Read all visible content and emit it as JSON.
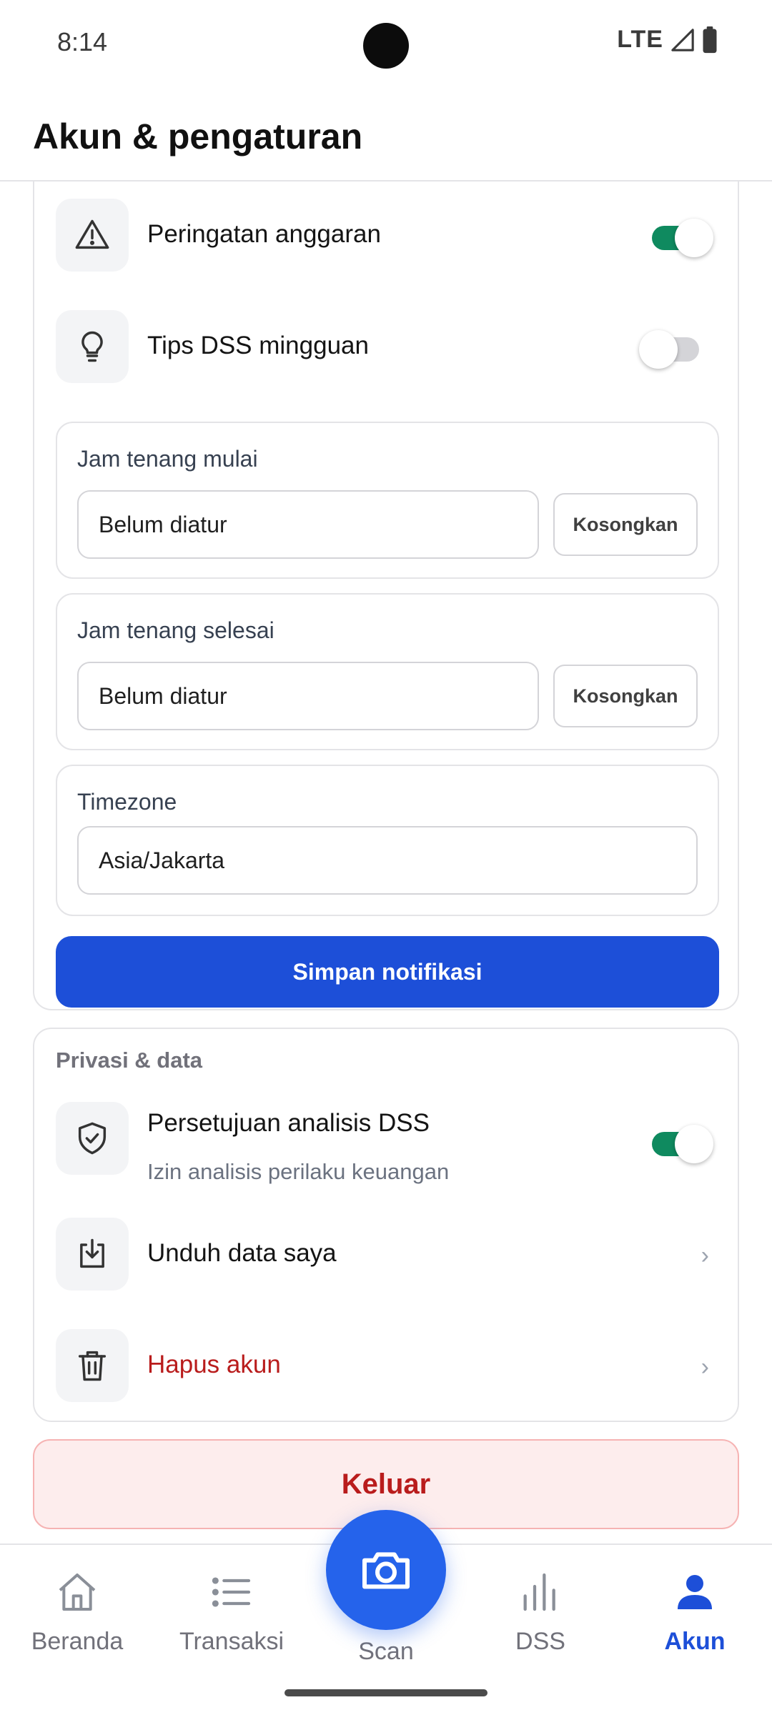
{
  "status_bar": {
    "time": "8:14",
    "network": "LTE"
  },
  "header": {
    "title": "Akun & pengaturan"
  },
  "notifications": {
    "budget_warning": {
      "label": "Peringatan anggaran",
      "enabled": true,
      "icon": "warning-triangle-icon"
    },
    "weekly_tips": {
      "label": "Tips DSS mingguan",
      "enabled": false,
      "icon": "lightbulb-icon"
    },
    "quiet_start": {
      "label": "Jam tenang mulai",
      "value": "Belum diatur",
      "clear_label": "Kosongkan"
    },
    "quiet_end": {
      "label": "Jam tenang selesai",
      "value": "Belum diatur",
      "clear_label": "Kosongkan"
    },
    "timezone": {
      "label": "Timezone",
      "value": "Asia/Jakarta"
    },
    "save_label": "Simpan notifikasi"
  },
  "privacy": {
    "title": "Privasi & data",
    "consent": {
      "label": "Persetujuan analisis DSS",
      "sublabel": "Izin analisis perilaku keuangan",
      "enabled": true,
      "icon": "shield-check-icon"
    },
    "download": {
      "label": "Unduh data saya",
      "icon": "download-icon"
    },
    "delete": {
      "label": "Hapus akun",
      "icon": "trash-icon"
    }
  },
  "logout_label": "Keluar",
  "nav": {
    "items": [
      {
        "label": "Beranda",
        "icon": "home-icon"
      },
      {
        "label": "Transaksi",
        "icon": "list-icon"
      },
      {
        "label": "Scan",
        "icon": "camera-icon"
      },
      {
        "label": "DSS",
        "icon": "bar-chart-icon"
      },
      {
        "label": "Akun",
        "icon": "user-icon",
        "active": true
      }
    ]
  },
  "colors": {
    "primary": "#1d4fd8",
    "toggle_on": "#0f8a5f",
    "danger": "#b91c1c",
    "logout_bg": "#fdeded"
  }
}
